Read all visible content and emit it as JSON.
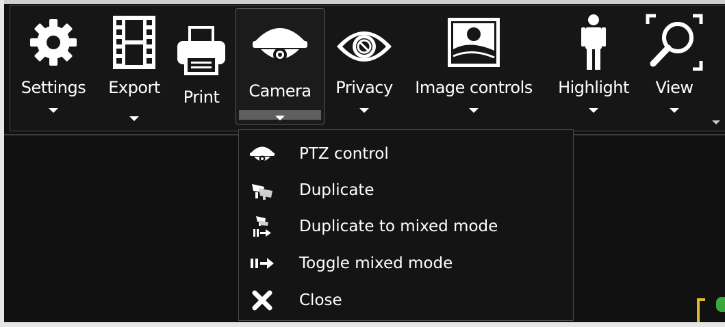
{
  "toolbar": {
    "items": [
      {
        "label": "Settings",
        "icon": "gear-icon",
        "has_dropdown": true
      },
      {
        "label": "Export",
        "icon": "film-strip-icon",
        "has_dropdown": true
      },
      {
        "label": "Print",
        "icon": "printer-icon",
        "has_dropdown": false
      },
      {
        "label": "Camera",
        "icon": "dome-camera-icon",
        "has_dropdown": true,
        "active": true
      },
      {
        "label": "Privacy",
        "icon": "privacy-eye-icon",
        "has_dropdown": true
      },
      {
        "label": "Image controls",
        "icon": "image-landscape-icon",
        "has_dropdown": true
      },
      {
        "label": "Highlight",
        "icon": "person-icon",
        "has_dropdown": true
      },
      {
        "label": "View",
        "icon": "magnifier-icon",
        "has_dropdown": true
      }
    ]
  },
  "camera_menu": {
    "items": [
      {
        "label": "PTZ control",
        "icon": "dome-camera-icon"
      },
      {
        "label": "Duplicate",
        "icon": "duplicate-camera-icon"
      },
      {
        "label": "Duplicate to mixed mode",
        "icon": "duplicate-mixed-mode-icon"
      },
      {
        "label": "Toggle mixed mode",
        "icon": "mixed-mode-arrow-icon"
      },
      {
        "label": "Close",
        "icon": "close-x-icon"
      }
    ]
  },
  "colors": {
    "background": "#111111",
    "toolbar_bg": "#161616",
    "text": "#ffffff",
    "border": "#4a4a4a",
    "active_bar": "#5f5f5f"
  }
}
